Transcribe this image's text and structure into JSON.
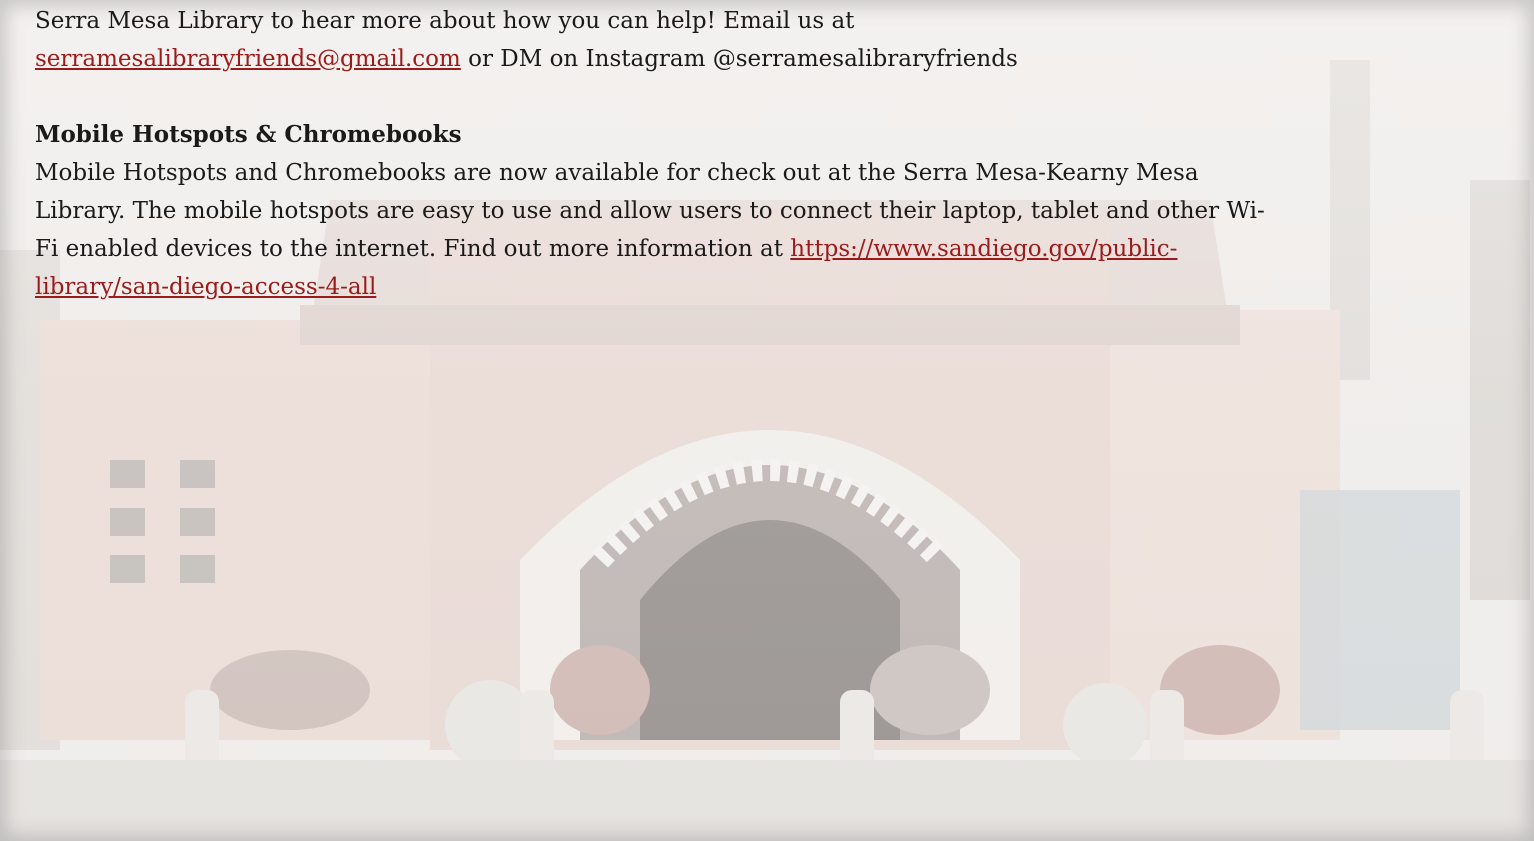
{
  "intro": {
    "line1": "Serra Mesa Library to hear more about how you can help! Email us at",
    "email_link": "serramesalibraryfriends@gmail.com",
    "line2_rest": " or DM on Instagram @serramesalibraryfriends"
  },
  "section": {
    "heading": "Mobile Hotspots & Chromebooks",
    "line1": "Mobile Hotspots and Chromebooks are now available for check out at the Serra Mesa-Kearny Mesa",
    "line2": "Library. The mobile hotspots are easy to use and allow users to connect their laptop, tablet and other Wi-",
    "line3_text": "Fi enabled devices to the internet. Find out more information at ",
    "link_part1": "https://www.sandiego.gov/public-",
    "link_part2": "library/san-diego-access-4-all"
  },
  "colors": {
    "link": "#9b1b1b",
    "text": "#1a1a1a"
  }
}
